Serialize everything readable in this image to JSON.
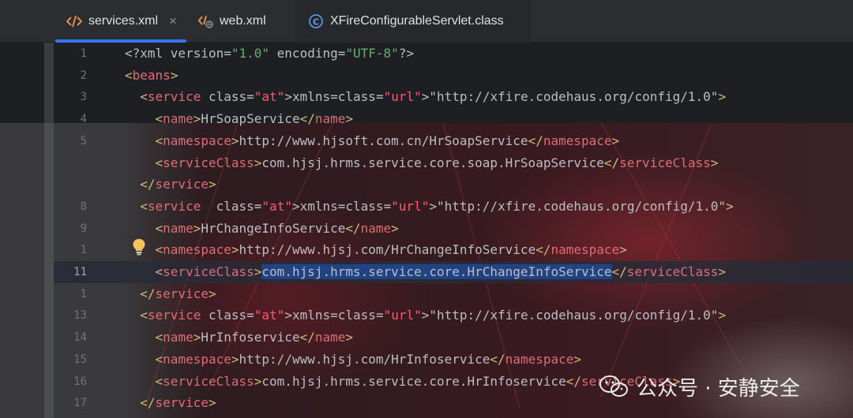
{
  "tabs": [
    {
      "label": "services.xml",
      "icon": "xml-code-icon",
      "active": true,
      "has_close": true
    },
    {
      "label": "web.xml",
      "icon": "web-xml-icon",
      "active": false
    },
    {
      "label": "XFireConfigurableServlet.class",
      "icon": "class-c-icon",
      "active": false
    }
  ],
  "tab_close_glyph": "×",
  "current_line": "11",
  "lines": [
    {
      "n": "1",
      "text": "<?xml version=\"1.0\" encoding=\"UTF-8\"?>"
    },
    {
      "n": "2",
      "text": "<beans>"
    },
    {
      "n": "3",
      "text": "  <service xmlns=\"http://xfire.codehaus.org/config/1.0\">"
    },
    {
      "n": "4",
      "text": "    <name>HrSoapService</name>"
    },
    {
      "n": "5",
      "text": "    <namespace>http://www.hjsoft.com.cn/HrSoapService</namespace>"
    },
    {
      "n": "",
      "text": "    <serviceClass>com.hjsj.hrms.service.core.soap.HrSoapService</serviceClass>"
    },
    {
      "n": "",
      "text": "  </service>"
    },
    {
      "n": "8",
      "text": "  <service  xmlns=\"http://xfire.codehaus.org/config/1.0\">"
    },
    {
      "n": "9",
      "text": "    <name>HrChangeInfoService</name>"
    },
    {
      "n": "1",
      "text": "    <namespace>http://www.hjsj.com/HrChangeInfoService</namespace>"
    },
    {
      "n": "11",
      "text": "    <serviceClass>com.hjsj.hrms.service.core.HrChangeInfoService</serviceClass>"
    },
    {
      "n": "1",
      "text": "  </service>"
    },
    {
      "n": "13",
      "text": "  <service xmlns=\"http://xfire.codehaus.org/config/1.0\">"
    },
    {
      "n": "14",
      "text": "    <name>HrInfoservice</name>"
    },
    {
      "n": "15",
      "text": "    <namespace>http://www.hjsj.com/HrInfoservice</namespace>"
    },
    {
      "n": "16",
      "text": "    <serviceClass>com.hjsj.hrms.service.core.HrInfoservice</serviceClass>"
    },
    {
      "n": "17",
      "text": "  </service>"
    }
  ],
  "selection_text": "com.hjsj.hrms.service.core.HrChangeInfoService",
  "watermark": "公众号 · 安静安全",
  "colors": {
    "accent": "#3574f0",
    "tag_name": "#e06c75",
    "url_string": "#ff5a6e",
    "string": "#6aab73",
    "selection": "#214283"
  }
}
